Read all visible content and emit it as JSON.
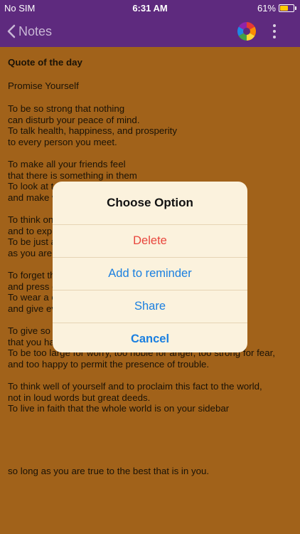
{
  "status_bar": {
    "carrier": "No SIM",
    "time": "6:31 AM",
    "battery_percent": "61%",
    "battery_level": 0.61
  },
  "nav": {
    "back_label": "Notes"
  },
  "note": {
    "title": "Quote of the day",
    "subtitle": "Promise Yourself",
    "paragraphs": [
      [
        "To be so strong that nothing",
        "can disturb your peace of mind.",
        "To talk health, happiness, and prosperity",
        "to every person you meet."
      ],
      [
        "To make all your friends feel",
        "that there is something in them",
        "To look at t",
        "and make w"
      ],
      [
        "To think on",
        "and to exp",
        "To be just a",
        "as you are"
      ],
      [
        "To forget th",
        "and press o",
        "To wear a c",
        "and give ev"
      ],
      [
        "To give so",
        "that you ha",
        "To be too large for worry, too noble for anger, too strong for fear,",
        "and too happy to permit the presence of trouble."
      ],
      [
        "To think well of yourself and to proclaim this fact to the world,",
        "not in loud words but great deeds.",
        "To live in faith that the whole world is on your sidebar"
      ]
    ],
    "closing": "so long as you are true to the best that is in you."
  },
  "dialog": {
    "title": "Choose Option",
    "options": {
      "delete": "Delete",
      "reminder": "Add to reminder",
      "share": "Share",
      "cancel": "Cancel"
    }
  },
  "colors": {
    "nav_background": "#5e2a7e",
    "note_background": "#a1621a",
    "dialog_background": "#fbf2dd",
    "delete_red": "#e8453c",
    "action_blue": "#1a7fe0"
  }
}
